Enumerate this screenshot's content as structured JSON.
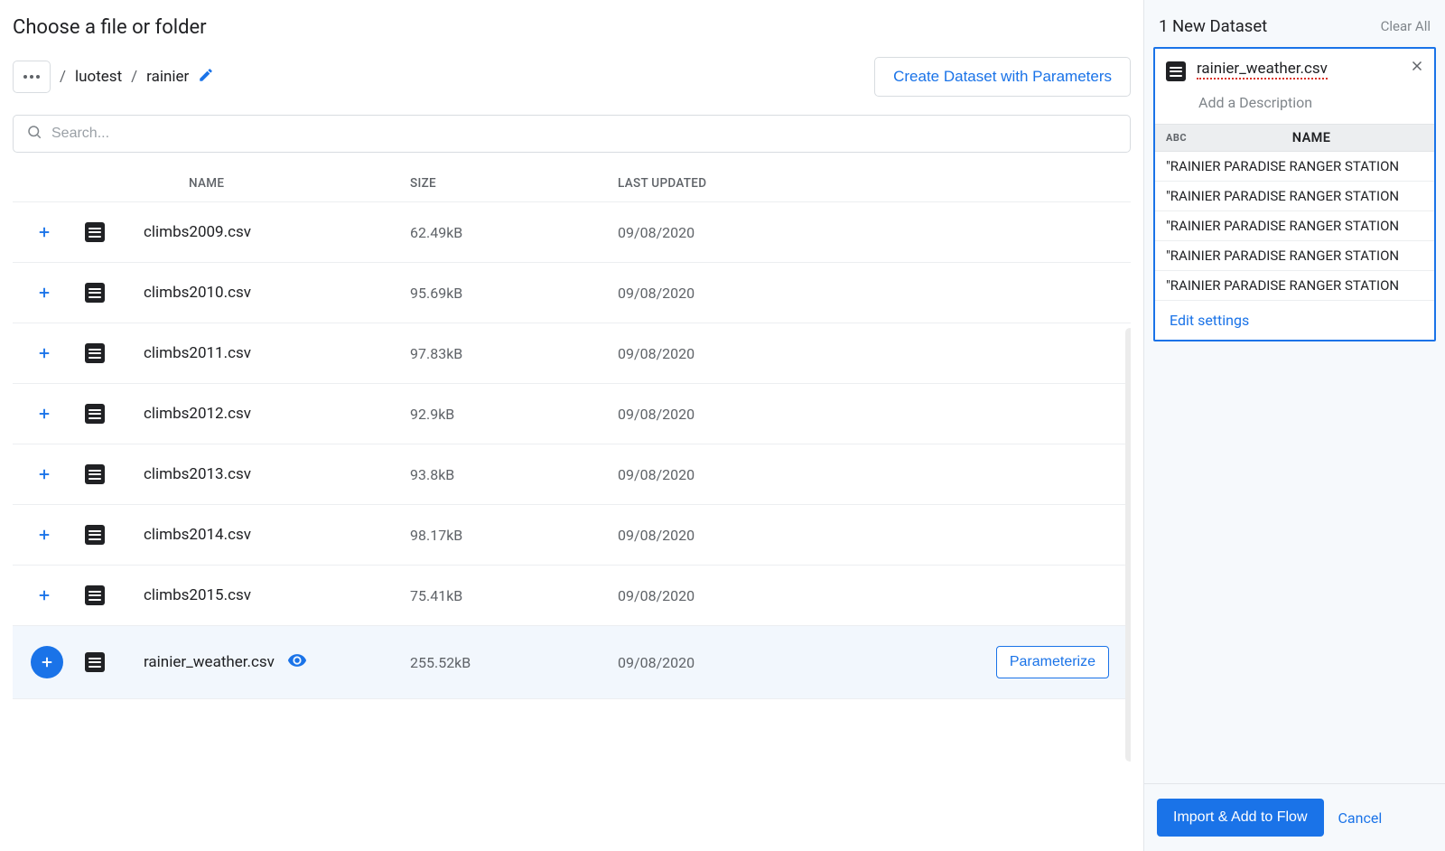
{
  "main": {
    "title": "Choose a file or folder",
    "breadcrumb": [
      "luotest",
      "rainier"
    ],
    "create_button": "Create Dataset with Parameters",
    "search_placeholder": "Search...",
    "columns": {
      "name": "NAME",
      "size": "SIZE",
      "updated": "LAST UPDATED"
    },
    "parameterize_label": "Parameterize",
    "files": [
      {
        "name": "climbs2009.csv",
        "size": "62.49kB",
        "updated": "09/08/2020",
        "selected": false
      },
      {
        "name": "climbs2010.csv",
        "size": "95.69kB",
        "updated": "09/08/2020",
        "selected": false
      },
      {
        "name": "climbs2011.csv",
        "size": "97.83kB",
        "updated": "09/08/2020",
        "selected": false
      },
      {
        "name": "climbs2012.csv",
        "size": "92.9kB",
        "updated": "09/08/2020",
        "selected": false
      },
      {
        "name": "climbs2013.csv",
        "size": "93.8kB",
        "updated": "09/08/2020",
        "selected": false
      },
      {
        "name": "climbs2014.csv",
        "size": "98.17kB",
        "updated": "09/08/2020",
        "selected": false
      },
      {
        "name": "climbs2015.csv",
        "size": "75.41kB",
        "updated": "09/08/2020",
        "selected": false
      },
      {
        "name": "rainier_weather.csv",
        "size": "255.52kB",
        "updated": "09/08/2020",
        "selected": true
      }
    ]
  },
  "right": {
    "title": "1 New Dataset",
    "clear_all": "Clear All",
    "dataset": {
      "name": "rainier_weather.csv",
      "desc_placeholder": "Add a Description",
      "type_label": "ABC",
      "column_header": "NAME",
      "rows": [
        "\"RAINIER PARADISE RANGER STATION",
        "\"RAINIER PARADISE RANGER STATION",
        "\"RAINIER PARADISE RANGER STATION",
        "\"RAINIER PARADISE RANGER STATION",
        "\"RAINIER PARADISE RANGER STATION"
      ],
      "edit_settings": "Edit settings"
    },
    "import_button": "Import & Add to Flow",
    "cancel": "Cancel"
  }
}
